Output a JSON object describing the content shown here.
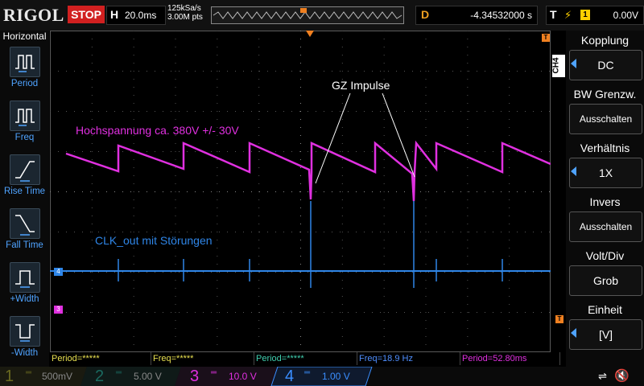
{
  "top": {
    "logo": "RIGOL",
    "run_state": "STOP",
    "horizontal_label": "H",
    "timebase": "20.0ms",
    "sample_rate": "125kSa/s",
    "memory_depth": "3.00M pts",
    "delay_label": "D",
    "delay_value": "-4.34532000 s",
    "trigger_label": "T",
    "trigger_icon": "rising-edge-icon",
    "trigger_channel": "1",
    "trigger_level": "0.00V"
  },
  "left_menu": {
    "title": "Horizontal",
    "items": [
      {
        "label": "Period",
        "icon": "period-icon"
      },
      {
        "label": "Freq",
        "icon": "freq-icon"
      },
      {
        "label": "Rise Time",
        "icon": "rise-time-icon"
      },
      {
        "label": "Fall Time",
        "icon": "fall-time-icon"
      },
      {
        "label": "+Width",
        "icon": "pos-width-icon"
      },
      {
        "label": "-Width",
        "icon": "neg-width-icon"
      }
    ]
  },
  "right_menu": {
    "channel_tab": "CH4",
    "items": [
      {
        "label": "Kopplung",
        "value": "DC",
        "arrow": true
      },
      {
        "label": "BW Grenzw.",
        "value": "Ausschalten",
        "arrow": false
      },
      {
        "label": "Verhältnis",
        "value": "1X",
        "arrow": true
      },
      {
        "label": "Invers",
        "value": "Ausschalten",
        "arrow": false
      },
      {
        "label": "Volt/Div",
        "value": "Grob",
        "arrow": false
      },
      {
        "label": "Einheit",
        "value": "[V]",
        "arrow": true
      }
    ]
  },
  "annotations": {
    "high_voltage": "Hochspannung ca. 380V +/- 30V",
    "clk": "CLK_out  mit Störungen",
    "gz": "GZ Impulse"
  },
  "markers": {
    "ch4": "4",
    "ch3": "3",
    "trigger_top": "T",
    "trigger_right": "T"
  },
  "measurements": [
    {
      "text": "Period=*****",
      "color": "#e8e050"
    },
    {
      "text": "Freq=*****",
      "color": "#e8e050"
    },
    {
      "text": "Period=*****",
      "color": "#40d0b0"
    },
    {
      "text": "Freq=18.9 Hz",
      "color": "#4f8fff"
    },
    {
      "text": "Period=52.80ms",
      "color": "#e030e0"
    }
  ],
  "channels": [
    {
      "num": "1",
      "scale": "500mV",
      "color": "#c8c820"
    },
    {
      "num": "2",
      "scale": "5.00 V",
      "color": "#20b0a0"
    },
    {
      "num": "3",
      "scale": "10.0 V",
      "color": "#e030e0"
    },
    {
      "num": "4",
      "scale": "1.00 V",
      "color": "#3a8eff"
    }
  ],
  "status": {
    "usb_icon": "usb-icon",
    "speaker_icon": "speaker-muted-icon"
  }
}
